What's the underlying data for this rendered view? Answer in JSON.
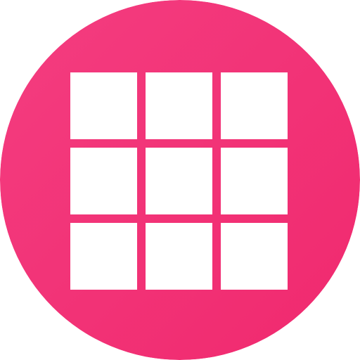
{
  "icon": {
    "name": "grid-app-icon",
    "shape": "circle",
    "colors": {
      "gradient_start": "#f43d80",
      "gradient_end": "#f0296e",
      "tile": "#ffffff"
    },
    "grid": {
      "rows": 3,
      "columns": 3
    }
  }
}
